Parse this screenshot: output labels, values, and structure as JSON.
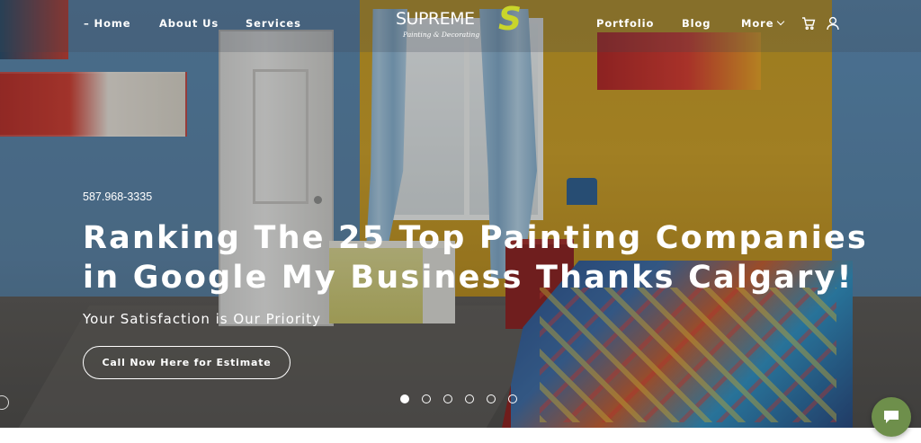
{
  "nav": {
    "home_label": "– Home",
    "about_label": "About Us",
    "services_label": "Services",
    "portfolio_label": "Portfolio",
    "blog_label": "Blog",
    "more_label": "More"
  },
  "logo": {
    "wordmark": "SUPREME",
    "tagline": "Painting & Decorating",
    "monogram": "S"
  },
  "hero": {
    "phone": "587.968-3335",
    "headline": "Ranking The 25 Top Painting Companies in Google My Business Thanks Calgary!",
    "tagline": "Your Satisfaction is Our Priority",
    "cta_label": "Call Now Here for Estimate"
  },
  "slider": {
    "total_slides": 6,
    "active_slide": 1
  },
  "icons": {
    "cart": "cart-icon",
    "account": "user-icon",
    "chat": "chat-icon",
    "more_dropdown": "chevron-down-icon"
  },
  "colors": {
    "logo_accent": "#c9d52a",
    "chat_button": "#6e8f4b",
    "text": "#ffffff"
  }
}
